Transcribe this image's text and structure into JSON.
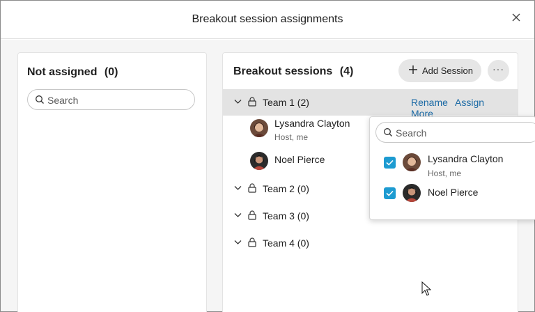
{
  "dialog": {
    "title": "Breakout session assignments",
    "close_icon": "close-icon"
  },
  "left_panel": {
    "title": "Not assigned",
    "count": "(0)",
    "search_placeholder": "Search"
  },
  "right_panel": {
    "title": "Breakout sessions",
    "count": "(4)",
    "add_session_label": "Add Session",
    "more_label": "···",
    "teams": [
      {
        "name": "Team 1 (2)",
        "expanded": true,
        "actions": [
          "Rename",
          "Assign",
          "More"
        ],
        "members": [
          {
            "name": "Lysandra Clayton",
            "subtitle": "Host, me"
          },
          {
            "name": "Noel Pierce",
            "subtitle": ""
          }
        ]
      },
      {
        "name": "Team 2 (0)",
        "expanded": false
      },
      {
        "name": "Team 3 (0)",
        "expanded": false
      },
      {
        "name": "Team 4 (0)",
        "expanded": false
      }
    ]
  },
  "assign_popover": {
    "search_placeholder": "Search",
    "items": [
      {
        "name": "Lysandra Clayton",
        "subtitle": "Host, me",
        "checked": true
      },
      {
        "name": "Noel Pierce",
        "subtitle": "",
        "checked": true
      }
    ]
  },
  "colors": {
    "accent": "#1d9bd1",
    "link": "#1b6aa5",
    "selected_row": "#e3e3e3",
    "background": "#f5f5f5"
  }
}
